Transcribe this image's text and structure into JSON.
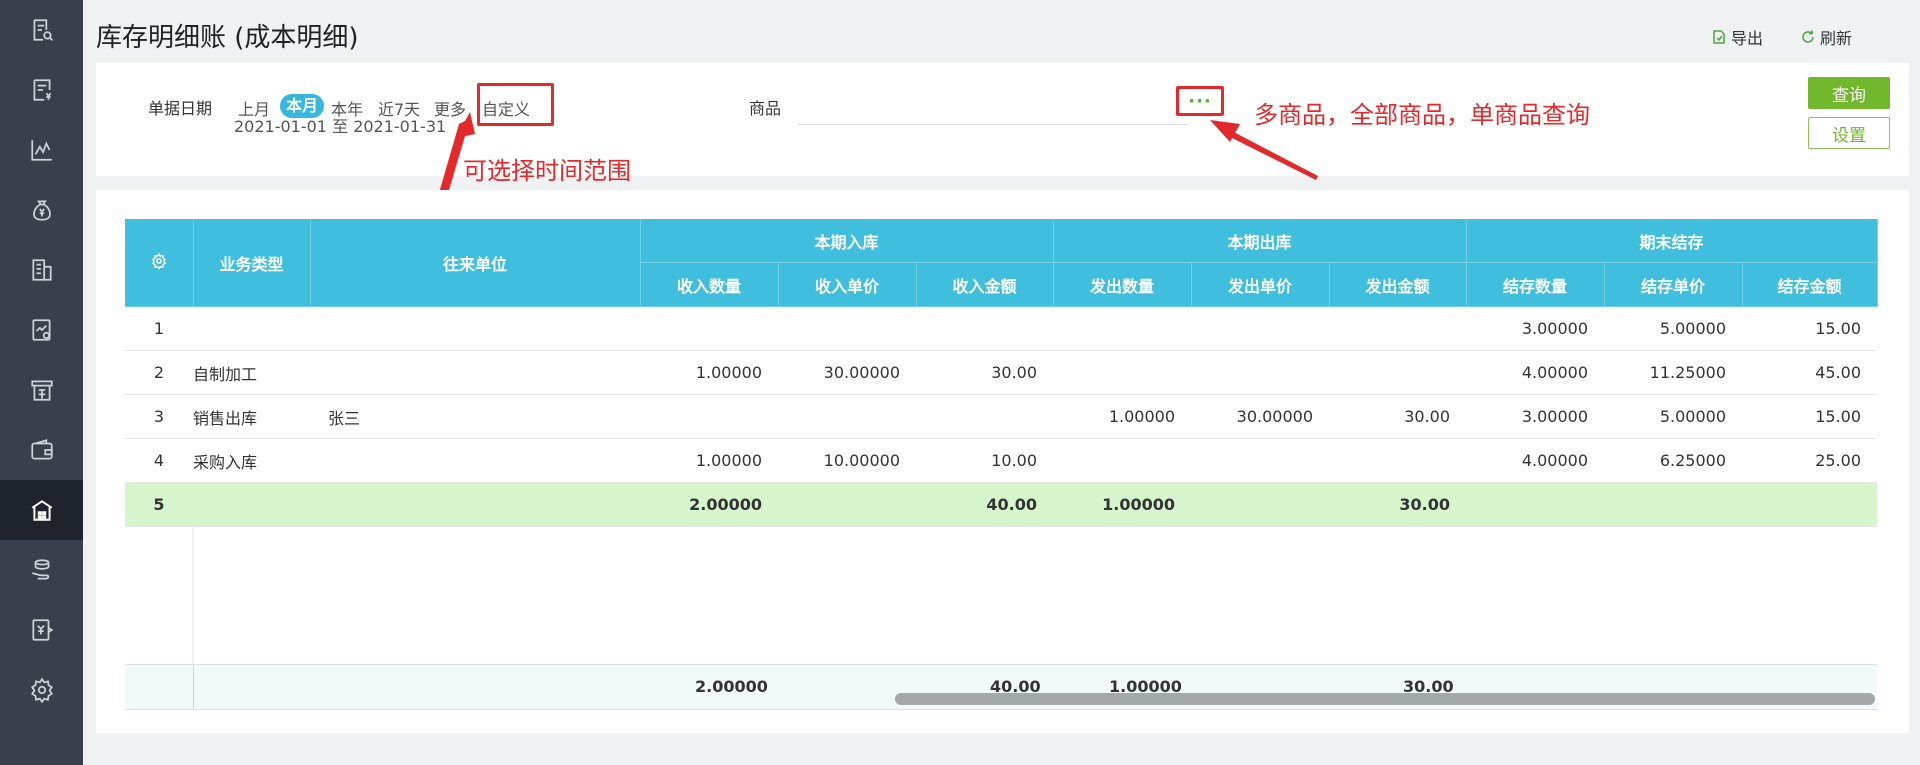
{
  "page": {
    "title": "库存明细账 (成本明细)",
    "export_label": "导出",
    "refresh_label": "刷新"
  },
  "sidebar": {
    "items": [
      {
        "icon": "document-search-icon"
      },
      {
        "icon": "invoice-icon"
      },
      {
        "icon": "line-chart-icon"
      },
      {
        "icon": "money-bag-icon"
      },
      {
        "icon": "buildings-icon"
      },
      {
        "icon": "report-chart-icon"
      },
      {
        "icon": "storefront-icon"
      },
      {
        "icon": "wallet-icon"
      },
      {
        "icon": "warehouse-icon",
        "active": true
      },
      {
        "icon": "coins-hand-icon"
      },
      {
        "icon": "voucher-icon"
      },
      {
        "icon": "settings-icon"
      }
    ]
  },
  "filter": {
    "date_label": "单据日期",
    "ranges": [
      "上月",
      "本月",
      "本年",
      "近7天",
      "更多",
      "自定义"
    ],
    "active_range": "本月",
    "date_from": "2021-01-01",
    "date_sep": "至",
    "date_to": "2021-01-31",
    "product_label": "商品",
    "product_value": "",
    "more_button": "···",
    "query_button": "查询",
    "settings_button": "设置"
  },
  "annotations": {
    "time_range": "可选择时间范围",
    "product_query": "多商品，全部商品，单商品查询"
  },
  "table": {
    "headers": {
      "biz_type": "业务类型",
      "partner": "往来单位",
      "group_in": "本期入库",
      "group_out": "本期出库",
      "group_end": "期末结存",
      "in_qty": "收入数量",
      "in_price": "收入单价",
      "in_amount": "收入金额",
      "out_qty": "发出数量",
      "out_price": "发出单价",
      "out_amount": "发出金额",
      "end_qty": "结存数量",
      "end_price": "结存单价",
      "end_amount": "结存金额"
    },
    "rows": [
      {
        "idx": "1",
        "biz_type": "",
        "partner": "",
        "in_qty": "",
        "in_price": "",
        "in_amount": "",
        "out_qty": "",
        "out_price": "",
        "out_amount": "",
        "end_qty": "3.00000",
        "end_price": "5.00000",
        "end_amount": "15.00"
      },
      {
        "idx": "2",
        "biz_type": "自制加工",
        "partner": "",
        "in_qty": "1.00000",
        "in_price": "30.00000",
        "in_amount": "30.00",
        "out_qty": "",
        "out_price": "",
        "out_amount": "",
        "end_qty": "4.00000",
        "end_price": "11.25000",
        "end_amount": "45.00"
      },
      {
        "idx": "3",
        "biz_type": "销售出库",
        "partner": "张三",
        "in_qty": "",
        "in_price": "",
        "in_amount": "",
        "out_qty": "1.00000",
        "out_price": "30.00000",
        "out_amount": "30.00",
        "end_qty": "3.00000",
        "end_price": "5.00000",
        "end_amount": "15.00"
      },
      {
        "idx": "4",
        "biz_type": "采购入库",
        "partner": "",
        "in_qty": "1.00000",
        "in_price": "10.00000",
        "in_amount": "10.00",
        "out_qty": "",
        "out_price": "",
        "out_amount": "",
        "end_qty": "4.00000",
        "end_price": "6.25000",
        "end_amount": "25.00"
      },
      {
        "idx": "5",
        "biz_type": "",
        "partner": "",
        "in_qty": "2.00000",
        "in_price": "",
        "in_amount": "40.00",
        "out_qty": "1.00000",
        "out_price": "",
        "out_amount": "30.00",
        "end_qty": "",
        "end_price": "",
        "end_amount": ""
      }
    ],
    "footer": {
      "in_qty": "2.00000",
      "in_amount": "40.00",
      "out_qty": "1.00000",
      "out_amount": "30.00"
    }
  },
  "colors": {
    "header_bg": "#3fbfdd",
    "summary_row_bg": "#d7f5cc",
    "primary_green": "#71b82d",
    "annotation_red": "#e5292a",
    "sidebar_bg": "#3a3f4c"
  }
}
